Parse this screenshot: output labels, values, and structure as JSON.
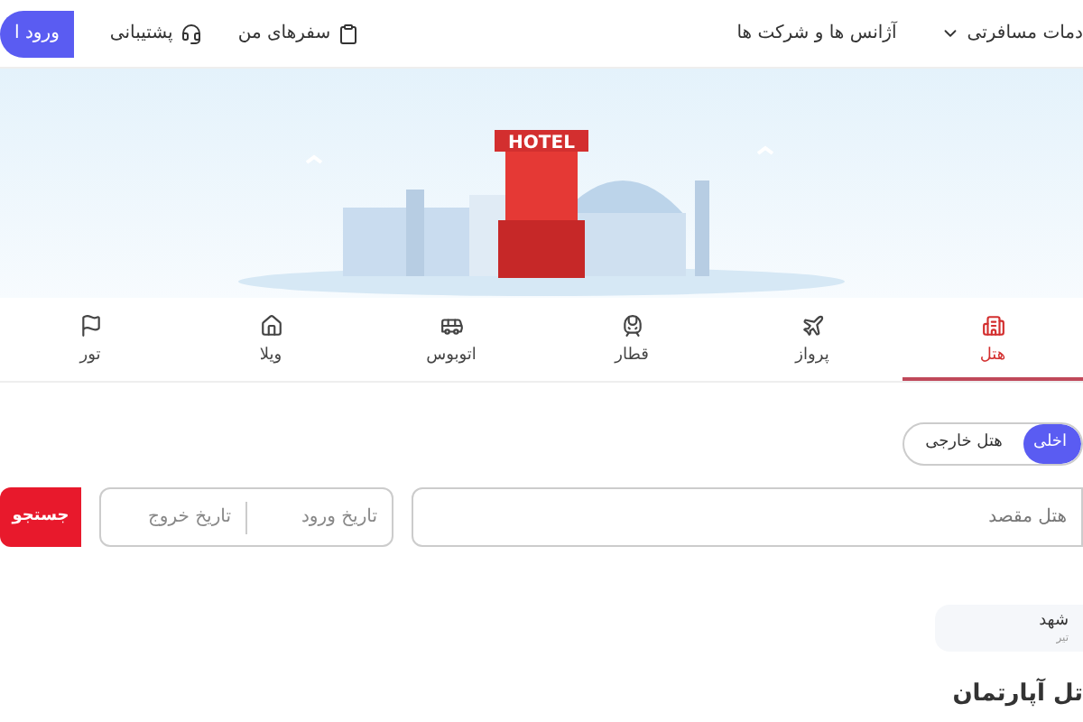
{
  "header": {
    "nav": [
      {
        "label": "دمات مسافرتی",
        "has_caret": true
      },
      {
        "label": "آژانس ها و شرکت ها",
        "has_caret": false
      }
    ],
    "links": [
      {
        "label": "سفرهای من",
        "kind": "trips"
      },
      {
        "label": "پشتیبانی",
        "kind": "support"
      }
    ],
    "login_button": "ورود ا"
  },
  "banner": {
    "sign": "HOTEL"
  },
  "tabs": [
    {
      "label": "هتل",
      "kind": "hotel",
      "selected": true
    },
    {
      "label": "پرواز",
      "kind": "flight",
      "selected": false
    },
    {
      "label": "قطار",
      "kind": "train",
      "selected": false
    },
    {
      "label": "اتوبوس",
      "kind": "bus",
      "selected": false
    },
    {
      "label": "ویلا",
      "kind": "villa",
      "selected": false
    },
    {
      "label": "تور",
      "kind": "tour",
      "selected": false
    }
  ],
  "scope_toggle": [
    {
      "label": "اخلی",
      "selected": true
    },
    {
      "label": "هتل خارجی",
      "selected": false
    }
  ],
  "search": {
    "destination_placeholder": "هتل مقصد",
    "checkin_placeholder": "تاریخ ورود",
    "checkout_placeholder": "تاریخ خروج",
    "button": "جستجو"
  },
  "recent": [
    {
      "title": "شهد",
      "subtitle": "تیر"
    }
  ],
  "section_heading": "تل آپارتمان"
}
